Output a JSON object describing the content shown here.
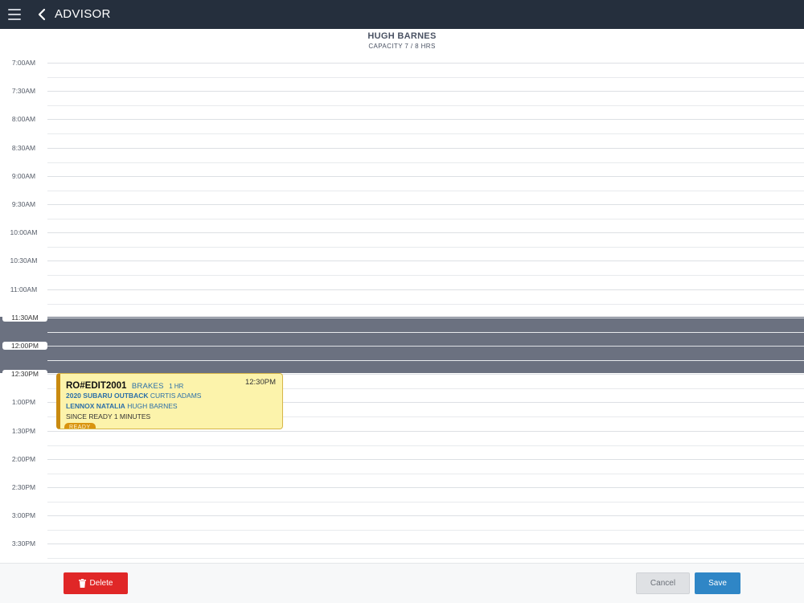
{
  "topbar": {
    "title": "ADVISOR",
    "menu_icon": "hamburger-menu-icon",
    "back_icon": "chevron-left-icon"
  },
  "header": {
    "advisor_name": "HUGH BARNES",
    "capacity": "CAPACITY 7 / 8 HRS"
  },
  "schedule": {
    "time_slots": [
      "7:00AM",
      "7:30AM",
      "8:00AM",
      "8:30AM",
      "9:00AM",
      "9:30AM",
      "10:00AM",
      "10:30AM",
      "11:00AM",
      "11:30AM",
      "12:00PM",
      "12:30PM",
      "1:00PM",
      "1:30PM",
      "2:00PM",
      "2:30PM",
      "3:00PM",
      "3:30PM"
    ],
    "blocked_color": "#6b7180"
  },
  "appointment": {
    "ro_number": "RO#EDIT2001",
    "service": "BRAKES",
    "duration": "1 HR",
    "time": "12:30PM",
    "vehicle": "2020 SUBARU OUTBACK",
    "owner": "CURTIS ADAMS",
    "customer": "LENNOX NATALIA",
    "advisor": "HUGH BARNES",
    "since": "SINCE READY 1 MINUTES",
    "status": "READY",
    "accent_color": "#c98a10",
    "background_color": "#fcf3ab"
  },
  "footer": {
    "delete_label": "Delete",
    "cancel_label": "Cancel",
    "save_label": "Save",
    "delete_icon": "trash-icon",
    "delete_color": "#e02727",
    "save_color": "#2f86c6"
  }
}
